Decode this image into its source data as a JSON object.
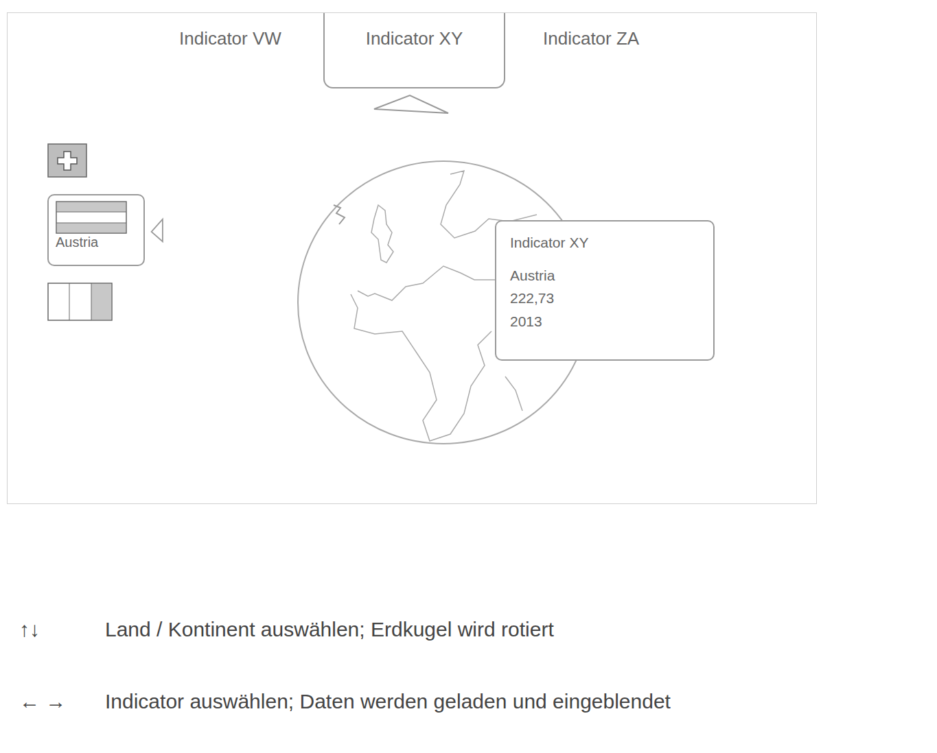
{
  "indicators": [
    {
      "label": "Indicator VW",
      "selected": false
    },
    {
      "label": "Indicator XY",
      "selected": true
    },
    {
      "label": "Indicator ZA",
      "selected": false
    }
  ],
  "countries": [
    {
      "kind": "switzerland",
      "selected": false
    },
    {
      "kind": "austria",
      "selected": true,
      "label": "Austria"
    },
    {
      "kind": "italy",
      "selected": false
    }
  ],
  "tooltip": {
    "title": "Indicator XY",
    "country": "Austria",
    "value": "222,73",
    "year": "2013"
  },
  "legend": [
    {
      "keys": "↑↓",
      "text": "Land / Kontinent auswählen; Erdkugel wird rotiert"
    },
    {
      "keys": "← →",
      "text": "Indicator auswählen; Daten werden geladen und eingeblendet"
    }
  ]
}
